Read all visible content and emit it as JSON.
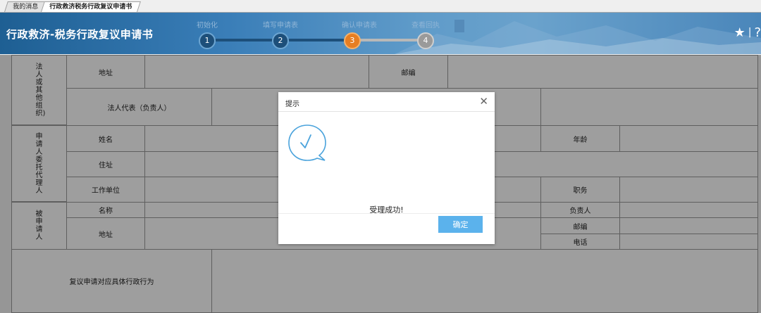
{
  "tabs": [
    "我的消息",
    "行政救济税务行政复议申请书"
  ],
  "header": {
    "title": "行政救济-税务行政复议申请书",
    "steps": [
      {
        "label": "初始化",
        "num": "1"
      },
      {
        "label": "填写申请表",
        "num": "2"
      },
      {
        "label": "确认申请表",
        "num": "3"
      },
      {
        "label": "查看回执",
        "num": "4"
      }
    ],
    "current_step": 3,
    "star_icon": "star-icon",
    "help_icon": "help-icon"
  },
  "form": {
    "legal_group": "法人或其他组织)",
    "address_label": "地址",
    "postcode_label": "邮编",
    "legal_rep_label": "法人代表（负责人）",
    "agent_group": "申请人委托代理人",
    "name_label": "姓名",
    "age_label": "年龄",
    "residence_label": "住址",
    "workplace_label": "工作单位",
    "position_label": "职务",
    "respondent_group": "被申请人",
    "resp_name_label": "名称",
    "person_in_charge_label": "负责人",
    "resp_address_label": "地址",
    "resp_postcode_label": "邮编",
    "phone_label": "电话",
    "action_label": "复议申请对应具体行政行为"
  },
  "dialog": {
    "title": "提示",
    "message": "受理成功!",
    "confirm": "确定",
    "icon": "success-check-icon"
  },
  "colors": {
    "banner": "#2f6fa6",
    "step_done": "#1d4f7a",
    "step_current": "#e67e22",
    "step_pending": "#9a9a9a",
    "confirm_button": "#5bb2ec"
  }
}
